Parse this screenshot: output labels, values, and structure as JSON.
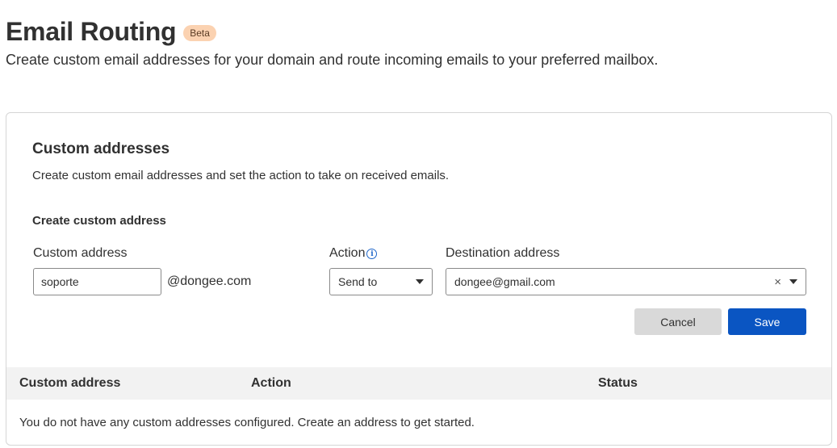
{
  "header": {
    "title": "Email Routing",
    "badge": "Beta",
    "subtitle": "Create custom email addresses for your domain and route incoming emails to your preferred mailbox."
  },
  "card": {
    "title": "Custom addresses",
    "description": "Create custom email addresses and set the action to take on received emails.",
    "form": {
      "heading": "Create custom address",
      "custom_address_label": "Custom address",
      "custom_address_value": "soporte",
      "domain_suffix": "@dongee.com",
      "action_label": "Action",
      "action_info_icon": "i",
      "action_value": "Send to",
      "destination_label": "Destination address",
      "destination_value": "dongee@gmail.com",
      "clear_glyph": "×",
      "cancel_label": "Cancel",
      "save_label": "Save"
    },
    "table": {
      "columns": [
        "Custom address",
        "Action",
        "Status"
      ],
      "empty_message": "You do not have any custom addresses configured. Create an address to get started."
    }
  },
  "colors": {
    "primary": "#0a55c2",
    "badge_bg": "#fbd2b1",
    "info": "#1f66c9"
  }
}
